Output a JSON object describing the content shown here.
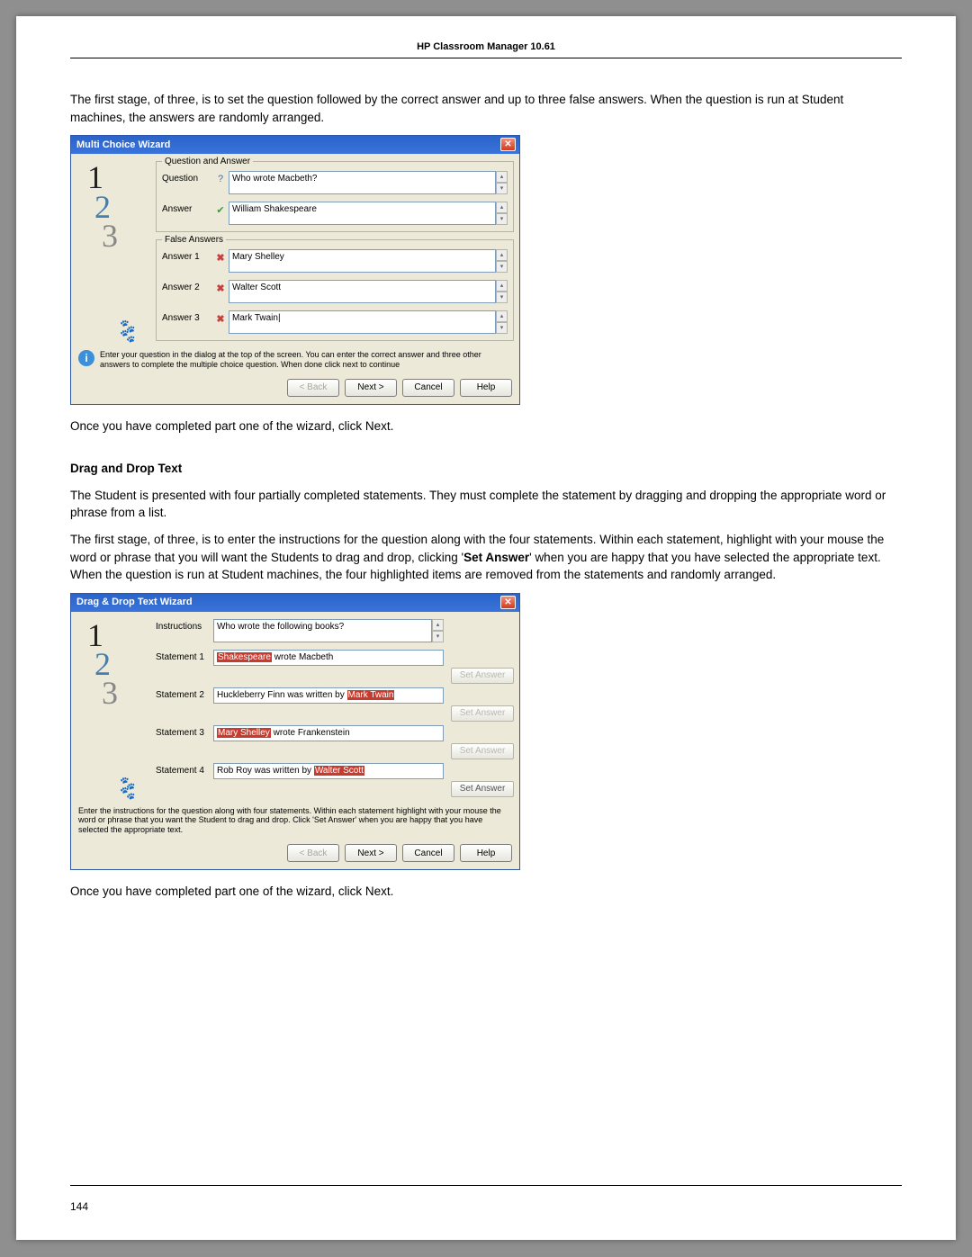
{
  "header": "HP Classroom Manager 10.61",
  "para1": "The first stage, of three, is to set the question followed by the correct answer and up to three false answers. When the question is run at Student machines, the answers are randomly arranged.",
  "para2": "Once you have completed part one of the wizard, click Next.",
  "ddHeading": "Drag and Drop Text",
  "para3": "The Student is presented with four partially completed statements. They must complete the statement by dragging and dropping the appropriate word or phrase from a list.",
  "para4a": "The first stage, of three, is to enter the instructions for the question along with the four statements. Within each statement, highlight with your mouse the word or phrase that you will want the Students to drag and drop, clicking '",
  "para4b": "Set Answer",
  "para4c": "' when you are happy that you have selected the appropriate text. When the question is run at Student machines, the four highlighted items are removed from the statements and randomly arranged.",
  "para5": "Once you have completed part one of the wizard, click Next.",
  "pageNumber": "144",
  "mc": {
    "title": "Multi Choice Wizard",
    "groupQA": "Question and Answer",
    "lblQuestion": "Question",
    "lblAnswer": "Answer",
    "question": "Who wrote Macbeth?",
    "answer": "William Shakespeare",
    "groupFalse": "False Answers",
    "lblA1": "Answer 1",
    "lblA2": "Answer 2",
    "lblA3": "Answer 3",
    "a1": "Mary Shelley",
    "a2": "Walter Scott",
    "a3": "Mark Twain|",
    "hint": "Enter your question in the dialog at the top of the screen. You can enter the correct answer and three other answers to complete the multiple choice question. When done click next to continue",
    "back": "< Back",
    "next": "Next >",
    "cancel": "Cancel",
    "help": "Help"
  },
  "dd": {
    "title": "Drag & Drop Text Wizard",
    "lblInstr": "Instructions",
    "instr": "Who wrote the following books?",
    "lblS1": "Statement 1",
    "lblS2": "Statement 2",
    "lblS3": "Statement 3",
    "lblS4": "Statement 4",
    "s1_hl": "Shakespeare",
    "s1_tail": " wrote Macbeth",
    "s2_head": "Huckleberry Finn was written by ",
    "s2_hl": "Mark Twain",
    "s3_hl": "Mary Shelley",
    "s3_tail": " wrote Frankenstein",
    "s4_head": "Rob Roy was written by ",
    "s4_hl": "Walter Scott",
    "setAnswer": "Set Answer",
    "hint": "Enter the instructions for the question along with four statements. Within each statement highlight with your mouse the word or phrase that you want the Student to drag and drop. Click 'Set Answer' when you are happy that you have selected the appropriate text.",
    "back": "< Back",
    "next": "Next >",
    "cancel": "Cancel",
    "help": "Help"
  }
}
